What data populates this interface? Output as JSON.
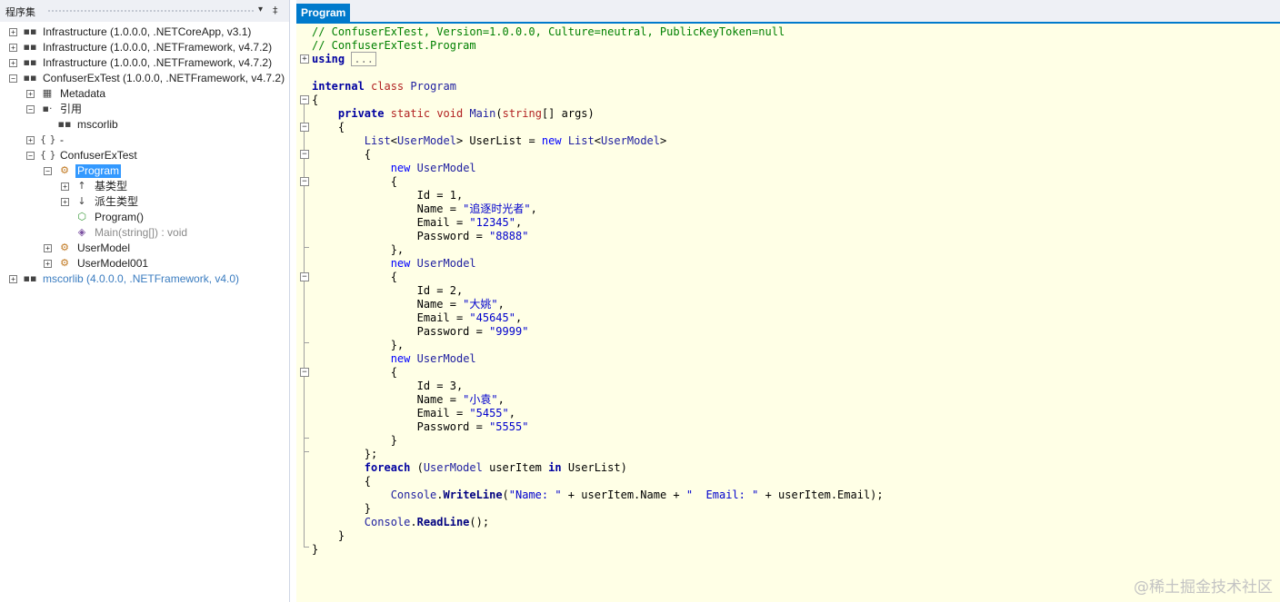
{
  "assembly_panel": {
    "title": "程序集",
    "menu_glyph": "▾",
    "pin_glyph": "‡"
  },
  "tree": [
    {
      "label": "Infrastructure (1.0.0.0, .NETCoreApp, v3.1)",
      "icon": "assembly-icon",
      "expander": "+"
    },
    {
      "label": "Infrastructure (1.0.0.0, .NETFramework, v4.7.2)",
      "icon": "assembly-icon",
      "expander": "+"
    },
    {
      "label": "Infrastructure (1.0.0.0, .NETFramework, v4.7.2)",
      "icon": "assembly-icon",
      "expander": "+"
    },
    {
      "label": "ConfuserExTest (1.0.0.0, .NETFramework, v4.7.2)",
      "icon": "assembly-icon",
      "expander": "−"
    },
    {
      "label": "Metadata",
      "icon": "metadata-icon",
      "expander": "+"
    },
    {
      "label": "引用",
      "icon": "references-icon",
      "expander": "−"
    },
    {
      "label": "mscorlib",
      "icon": "assembly-icon",
      "expander": ""
    },
    {
      "label": "-",
      "icon": "namespace-icon",
      "expander": "+"
    },
    {
      "label": "ConfuserExTest",
      "icon": "namespace-icon",
      "expander": "−"
    },
    {
      "label": "Program",
      "icon": "class-icon",
      "expander": "−",
      "selected": true
    },
    {
      "label": "基类型",
      "icon": "base-types-icon",
      "expander": "+"
    },
    {
      "label": "派生类型",
      "icon": "derived-types-icon",
      "expander": "+"
    },
    {
      "label": "Program()",
      "icon": "constructor-icon",
      "expander": ""
    },
    {
      "label": "Main(string[]) : void",
      "icon": "method-icon",
      "expander": ""
    },
    {
      "label": "UserModel",
      "icon": "class-icon",
      "expander": "+"
    },
    {
      "label": "UserModel001",
      "icon": "class-icon",
      "expander": "+"
    },
    {
      "label": "mscorlib (4.0.0.0, .NETFramework, v4.0)",
      "icon": "assembly-icon",
      "expander": "+"
    }
  ],
  "editor": {
    "tab_label": "Program",
    "header_comment_1": "// ConfuserExTest, Version=1.0.0.0, Culture=neutral, PublicKeyToken=null",
    "header_comment_2": "// ConfuserExTest.Program",
    "using_keyword": "using",
    "using_collapsed": "...",
    "kw_internal": "internal",
    "kw_class": "class",
    "class_name": "Program",
    "brace_open": "{",
    "brace_close": "}",
    "kw_private": "private",
    "kw_static": "static",
    "kw_void": "void",
    "method_name": "Main",
    "kw_string": "string",
    "params_tail": "[] args)",
    "list_type": "List",
    "user_model": "UserModel",
    "user_list": "UserList",
    "kw_new": "new",
    "users": [
      {
        "id": "1",
        "name": "\"追逐时光者\"",
        "email": "\"12345\"",
        "password": "\"8888\""
      },
      {
        "id": "2",
        "name": "\"大姚\"",
        "email": "\"45645\"",
        "password": "\"9999\""
      },
      {
        "id": "3",
        "name": "\"小袁\"",
        "email": "\"5455\"",
        "password": "\"5555\""
      }
    ],
    "kw_foreach": "foreach",
    "user_item": "userItem",
    "kw_in": "in",
    "console": "Console",
    "writeline": "WriteLine",
    "str_name": "\"Name: \"",
    "str_email": "\"  Email: \"",
    "readline": "ReadLine"
  },
  "watermark": "@稀土掘金技术社区"
}
